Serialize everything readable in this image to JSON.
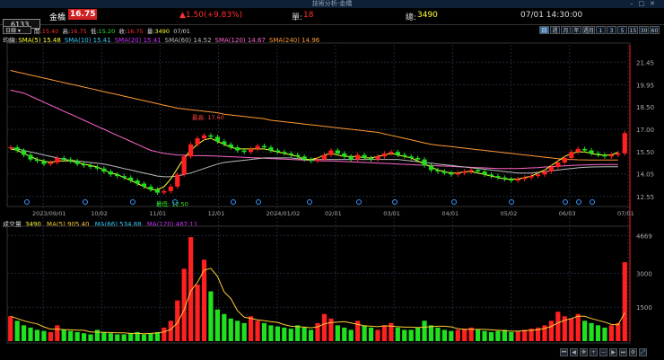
{
  "window": {
    "title": "技術分析-金橋"
  },
  "quote": {
    "code": "6133",
    "name": "金橋",
    "price": "16.75",
    "change": "▲1.50(+9.83%)",
    "single_label": "單:",
    "single_value": "18",
    "total_label": "總:",
    "total_value": "3490",
    "datetime": "07/01 14:30:00"
  },
  "toolbar": {
    "period": "日線",
    "open_label": "開:",
    "open": "15.40",
    "high_label": "高:",
    "high": "16.75",
    "low_label": "低:",
    "low": "15.20",
    "close_label": "收:",
    "close": "16.75",
    "vol_label": "量:",
    "vol": "3490",
    "date": "07/01",
    "timeframes": [
      "日",
      "週",
      "月",
      "年",
      "週月",
      "1",
      "3",
      "5",
      "15",
      "30",
      "60"
    ]
  },
  "ma_legend": {
    "title": "均線",
    "items": [
      {
        "label": "SMA(5) 15.48",
        "color": "#ffff33"
      },
      {
        "label": "SMA(10) 15.41",
        "color": "#33ccff"
      },
      {
        "label": "SMA(20) 15.41",
        "color": "#cc33ff"
      },
      {
        "label": "SMA(60) 14.52",
        "color": "#bbbbbb"
      },
      {
        "label": "SMA(120) 14.67",
        "color": "#ff66cc"
      },
      {
        "label": "SMA(240) 14.96",
        "color": "#ff9933"
      }
    ]
  },
  "vol_legend": {
    "title": "成交量",
    "value": "3490",
    "items": [
      {
        "label": "MA(5) 905.40",
        "color": "#ffcc33"
      },
      {
        "label": "MA(66) 534.88",
        "color": "#33ccff"
      },
      {
        "label": "MA(120) 467.11",
        "color": "#cc33ff"
      }
    ]
  },
  "annotations": {
    "high": "最高: 17.60",
    "low": "最低: 12.50"
  },
  "colors": {
    "up": "#ff2020",
    "down": "#20e020",
    "grid": "#1e2a3a",
    "axis": "#aaaaaa"
  },
  "chart_data": [
    {
      "type": "candlestick",
      "y_ticks": [
        12.55,
        14.05,
        15.5,
        17.0,
        18.5,
        19.95,
        21.45
      ],
      "y_tick_labels": [
        "12.55",
        "14.05",
        "15.50",
        "17.00",
        "18.50",
        "19.95",
        "21.45"
      ],
      "ylim": [
        12.0,
        22.6
      ],
      "x_tick_labels": [
        "2023/09/01",
        "10/02",
        "11/01",
        "12/01",
        "2024/01/02",
        "02/01",
        "03/01",
        "04/01",
        "05/02",
        "06/03",
        "07/01"
      ],
      "close": [
        15.8,
        15.6,
        15.3,
        15.0,
        14.9,
        14.7,
        14.8,
        15.1,
        15.0,
        14.9,
        14.7,
        14.6,
        14.5,
        14.4,
        14.2,
        14.0,
        13.9,
        13.8,
        13.6,
        13.4,
        13.2,
        13.0,
        12.8,
        12.9,
        13.2,
        14.0,
        15.2,
        16.0,
        16.4,
        16.6,
        16.5,
        16.2,
        16.0,
        15.8,
        15.6,
        15.5,
        15.7,
        15.9,
        15.8,
        15.6,
        15.5,
        15.4,
        15.3,
        15.2,
        15.0,
        14.9,
        15.0,
        15.3,
        15.6,
        15.4,
        15.2,
        15.0,
        15.3,
        15.1,
        15.0,
        15.2,
        15.4,
        15.5,
        15.3,
        15.2,
        15.1,
        15.0,
        14.6,
        14.3,
        14.2,
        14.1,
        14.0,
        14.1,
        14.2,
        14.3,
        14.2,
        14.0,
        13.9,
        13.8,
        13.7,
        13.6,
        13.7,
        13.8,
        13.9,
        14.0,
        14.2,
        14.5,
        14.8,
        15.1,
        15.5,
        15.7,
        15.6,
        15.4,
        15.3,
        15.2,
        15.3,
        15.4,
        16.75
      ],
      "ma5": [
        15.7,
        15.6,
        15.4,
        15.2,
        15.0,
        14.9,
        14.8,
        14.9,
        14.9,
        14.9,
        14.8,
        14.7,
        14.6,
        14.5,
        14.3,
        14.1,
        14.0,
        13.8,
        13.6,
        13.4,
        13.2,
        13.0,
        13.0,
        13.2,
        13.7,
        14.4,
        15.1,
        15.6,
        16.0,
        16.3,
        16.4,
        16.2,
        16.0,
        15.8,
        15.7,
        15.7,
        15.7,
        15.7,
        15.7,
        15.6,
        15.5,
        15.4,
        15.3,
        15.2,
        15.0,
        15.0,
        15.1,
        15.3,
        15.4,
        15.3,
        15.2,
        15.2,
        15.2,
        15.1,
        15.1,
        15.2,
        15.3,
        15.4,
        15.3,
        15.2,
        15.1,
        14.9,
        14.7,
        14.5,
        14.3,
        14.2,
        14.1,
        14.1,
        14.2,
        14.2,
        14.1,
        14.0,
        13.9,
        13.8,
        13.7,
        13.7,
        13.7,
        13.8,
        13.9,
        14.1,
        14.3,
        14.6,
        14.9,
        15.2,
        15.4,
        15.5,
        15.5,
        15.4,
        15.3,
        15.3,
        15.3,
        15.48
      ],
      "ma240": [
        20.9,
        20.8,
        20.7,
        20.6,
        20.5,
        20.4,
        20.3,
        20.2,
        20.1,
        20.0,
        19.9,
        19.8,
        19.7,
        19.6,
        19.5,
        19.4,
        19.3,
        19.2,
        19.1,
        19.0,
        18.9,
        18.8,
        18.7,
        18.6,
        18.5,
        18.4,
        18.35,
        18.3,
        18.25,
        18.2,
        18.15,
        18.1,
        18.0,
        17.95,
        17.9,
        17.85,
        17.8,
        17.75,
        17.7,
        17.6,
        17.55,
        17.5,
        17.45,
        17.4,
        17.35,
        17.3,
        17.25,
        17.2,
        17.15,
        17.1,
        17.05,
        17.0,
        16.95,
        16.9,
        16.85,
        16.8,
        16.7,
        16.6,
        16.5,
        16.4,
        16.3,
        16.2,
        16.1,
        16.0,
        15.95,
        15.9,
        15.85,
        15.8,
        15.75,
        15.7,
        15.65,
        15.6,
        15.55,
        15.5,
        15.45,
        15.4,
        15.35,
        15.3,
        15.25,
        15.2,
        15.15,
        15.1,
        15.05,
        15.0,
        15.0,
        14.98,
        14.97,
        14.96,
        14.96,
        14.96,
        14.96,
        14.96
      ],
      "ma120": [
        19.6,
        19.5,
        19.4,
        19.2,
        19.0,
        18.8,
        18.6,
        18.4,
        18.2,
        18.0,
        17.8,
        17.6,
        17.4,
        17.2,
        17.0,
        16.8,
        16.6,
        16.4,
        16.2,
        16.0,
        15.8,
        15.6,
        15.5,
        15.4,
        15.35,
        15.3,
        15.28,
        15.26,
        15.25,
        15.25,
        15.24,
        15.22,
        15.2,
        15.18,
        15.16,
        15.14,
        15.12,
        15.1,
        15.08,
        15.06,
        15.04,
        15.02,
        15.0,
        14.98,
        14.96,
        14.94,
        14.92,
        14.9,
        14.9,
        14.88,
        14.86,
        14.84,
        14.82,
        14.8,
        14.78,
        14.76,
        14.74,
        14.72,
        14.7,
        14.68,
        14.66,
        14.64,
        14.62,
        14.6,
        14.58,
        14.56,
        14.54,
        14.52,
        14.5,
        14.48,
        14.46,
        14.44,
        14.42,
        14.4,
        14.4,
        14.4,
        14.4,
        14.42,
        14.44,
        14.46,
        14.5,
        14.52,
        14.55,
        14.58,
        14.6,
        14.62,
        14.64,
        14.65,
        14.66,
        14.67,
        14.67,
        14.67
      ],
      "ma60": [
        15.8,
        15.7,
        15.6,
        15.5,
        15.4,
        15.3,
        15.2,
        15.1,
        15.0,
        14.95,
        14.9,
        14.85,
        14.8,
        14.75,
        14.7,
        14.6,
        14.5,
        14.4,
        14.3,
        14.2,
        14.1,
        14.0,
        13.9,
        13.85,
        13.85,
        13.9,
        14.0,
        14.1,
        14.25,
        14.4,
        14.55,
        14.7,
        14.8,
        14.85,
        14.9,
        14.95,
        15.0,
        15.05,
        15.1,
        15.1,
        15.1,
        15.1,
        15.1,
        15.05,
        15.0,
        15.0,
        15.0,
        15.0,
        15.0,
        15.0,
        15.0,
        15.0,
        15.0,
        15.0,
        15.0,
        15.0,
        15.0,
        15.0,
        15.0,
        14.95,
        14.9,
        14.85,
        14.8,
        14.75,
        14.7,
        14.65,
        14.6,
        14.55,
        14.5,
        14.45,
        14.4,
        14.35,
        14.3,
        14.25,
        14.2,
        14.15,
        14.1,
        14.1,
        14.1,
        14.15,
        14.2,
        14.25,
        14.3,
        14.35,
        14.4,
        14.45,
        14.48,
        14.5,
        14.51,
        14.52,
        14.52,
        14.52
      ]
    },
    {
      "type": "bar",
      "y_tick_labels": [
        "4669",
        "3000",
        "1500"
      ],
      "y_ticks": [
        4669,
        3000,
        1500
      ],
      "ylim": [
        0,
        5000
      ],
      "values": [
        1100,
        900,
        700,
        600,
        500,
        450,
        400,
        700,
        500,
        450,
        400,
        350,
        300,
        500,
        400,
        350,
        300,
        300,
        350,
        400,
        300,
        350,
        400,
        600,
        900,
        1800,
        3200,
        4600,
        2500,
        3600,
        2200,
        1400,
        1200,
        1000,
        900,
        800,
        1100,
        900,
        800,
        700,
        650,
        600,
        550,
        700,
        600,
        500,
        800,
        1200,
        1000,
        700,
        600,
        500,
        900,
        700,
        600,
        500,
        700,
        800,
        600,
        500,
        500,
        600,
        900,
        700,
        600,
        500,
        450,
        500,
        550,
        600,
        500,
        450,
        400,
        450,
        500,
        400,
        450,
        500,
        550,
        600,
        700,
        900,
        1300,
        1100,
        1000,
        1200,
        900,
        800,
        700,
        600,
        700,
        800,
        3490
      ]
    }
  ]
}
